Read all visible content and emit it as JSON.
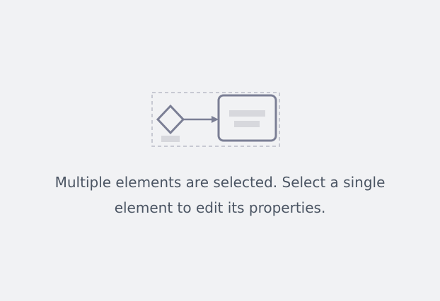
{
  "empty_state": {
    "message_line1": "Multiple elements are selected. Select a single",
    "message_line2": "element to edit its properties.",
    "illustration_icon": "multi-selection-diagram-icon"
  },
  "colors": {
    "background": "#f1f2f4",
    "text": "#4b5563",
    "stroke": "#7b7f95",
    "placeholder": "#d7d8dd",
    "selection_border": "#b9bbc6"
  }
}
